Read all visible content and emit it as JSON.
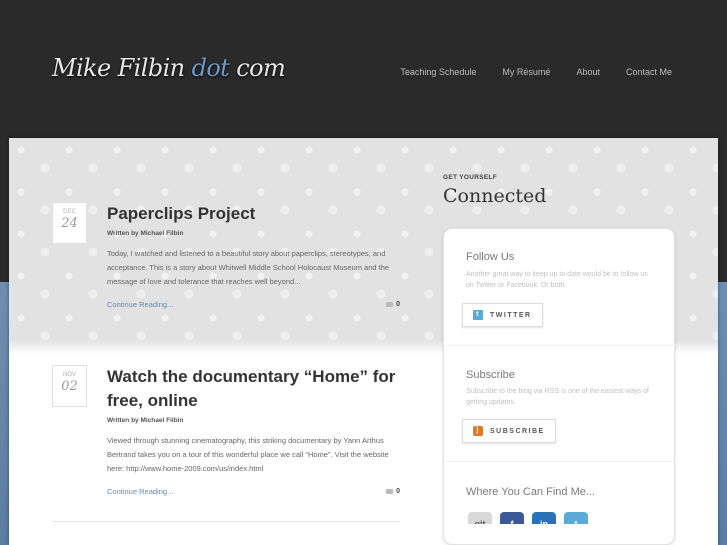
{
  "header": {
    "logo": {
      "part1": "Mike Filbin ",
      "dot": "dot",
      "part2": " com"
    },
    "nav": [
      {
        "label": "Teaching Schedule"
      },
      {
        "label": "My Résumé"
      },
      {
        "label": "About"
      },
      {
        "label": "Contact Me"
      }
    ]
  },
  "posts": [
    {
      "month": "DEC",
      "day": "24",
      "title": "Paperclips Project",
      "byline": "Written by Michael Filbin",
      "excerpt": "Today, I watched and listened to a beautiful story about paperclips, stereotypes, and acceptance. This is a story about Whitwell Middle School Holocaust Museum and the message of love and tolerance that reaches well beyond...",
      "read_more": "Continue Reading...",
      "comments": "0"
    },
    {
      "month": "NOV",
      "day": "02",
      "title": "Watch the documentary “Home” for free, online",
      "byline": "Written by Michael Filbin",
      "excerpt": "Viewed through stunning cinematography, this striking documentary by Yann Arthus Bertrand takes you on a tour of this wonderful place we call “Home”. Visit the website here: http://www.home-2009.com/us/index.html",
      "read_more": "Continue Reading...",
      "comments": "0"
    }
  ],
  "sidebar": {
    "kicker": "GET YOURSELF",
    "heading": "Connected",
    "follow": {
      "title": "Follow Us",
      "desc": "Another great way to keep up to date would be to follow us on Twitter or Facebook. Or both.",
      "button": "TWITTER"
    },
    "subscribe": {
      "title": "Subscribe",
      "desc": "Subscribe to the blog via RSS is one of the easiest ways of getting updates.",
      "button": "SUBSCRIBE"
    },
    "find_me": {
      "title": "Where You Can Find Me...",
      "icons": [
        {
          "icon": "git-icon",
          "glyph": "git",
          "color": "#d9d9d9"
        },
        {
          "icon": "facebook-icon",
          "glyph": "f",
          "color": "#3b5998"
        },
        {
          "icon": "linkedin-icon",
          "glyph": "in",
          "color": "#2a73b8"
        },
        {
          "icon": "twitter-icon",
          "glyph": "t",
          "color": "#5aa9d6"
        }
      ]
    }
  }
}
